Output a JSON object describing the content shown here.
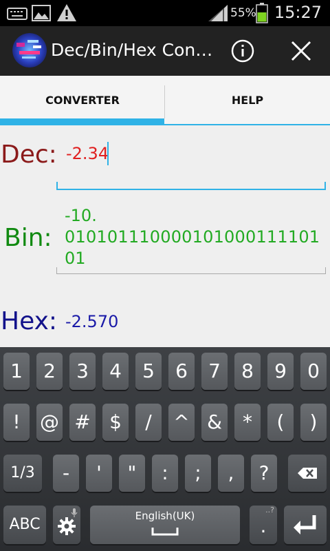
{
  "status_bar": {
    "battery_percent": "55%",
    "time": "15:27",
    "icons": [
      "keyboard-icon",
      "image-icon",
      "warning-icon",
      "signal-icon",
      "battery-icon"
    ]
  },
  "action_bar": {
    "title": "Dec/Bin/Hex Con…",
    "info_icon": "info-icon",
    "close_icon": "close-icon"
  },
  "tabs": [
    {
      "label": "CONVERTER",
      "selected": true
    },
    {
      "label": "HELP",
      "selected": false
    }
  ],
  "fields": {
    "dec": {
      "label": "Dec:",
      "value": "-2.34",
      "label_color": "#8b1a1a",
      "value_color": "#e02020"
    },
    "bin": {
      "label": "Bin:",
      "value_lines": [
        "-10.",
        "0101011100001010001111​01",
        "01"
      ],
      "label_color": "#118a11",
      "value_color": "#22aa22"
    },
    "hex": {
      "label": "Hex:",
      "value": "-2.570",
      "label_color": "#12128b",
      "value_color": "#1a1aa8"
    }
  },
  "keyboard": {
    "row1": [
      "1",
      "2",
      "3",
      "4",
      "5",
      "6",
      "7",
      "8",
      "9",
      "0"
    ],
    "row2": [
      "!",
      "@",
      "#",
      "$",
      "/",
      "^",
      "&",
      "*",
      "(",
      ")"
    ],
    "row3": [
      "1/3",
      "-",
      "'",
      "\"",
      ":",
      ";",
      ",",
      "?"
    ],
    "row3_backspace": "backspace-icon",
    "row4": {
      "abc": "ABC",
      "settings_icon": "gear-icon",
      "space_label": "English(UK)",
      "period": ".",
      "enter_icon": "enter-icon"
    }
  },
  "colors": {
    "accent": "#2fb2e6",
    "actionbar": "#222222",
    "keyboard_bg": "#2f3134"
  }
}
